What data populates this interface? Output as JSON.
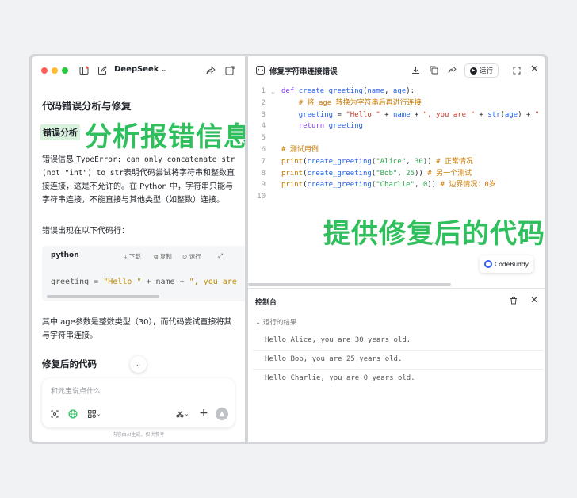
{
  "chat": {
    "app_name": "DeepSeek",
    "title": "代码错误分析与修复",
    "section_chip": "错误分析",
    "overlay_left": "分析报错信息",
    "para1_pre": "错误信息 ",
    "para1_code1": "TypeError: can only concatenate str (not \"int\") to str",
    "para1_post": "表明代码尝试将字符串和整数直接连接，这是不允许的。在 Python 中，字符串只能与字符串连接，不能直接与其他类型（如整数）连接。",
    "para2": "错误出现在以下代码行：",
    "code_block": {
      "lang": "python",
      "download": "下载",
      "copy": "复制",
      "run": "运行",
      "code_prefix": "greeting = ",
      "code_str1": "\"Hello \"",
      "code_mid": " + name + ",
      "code_str2": "\", you are"
    },
    "para3": "其中 age参数是整数类型（30），而代码尝试直接将其与字符串连接。",
    "subtitle": "修复后的代码",
    "input_placeholder": "和元宝说点什么",
    "footer_note": "内容由AI生成，仅供参考"
  },
  "code_panel": {
    "file_title": "修复字符串连接错误",
    "run_label": "运行",
    "overlay_right": "提供修复后的代码",
    "buddy_label": "CodeBuddy",
    "lines": [
      {
        "n": "1",
        "html": "<span class=\"kw\">def</span> <span class=\"fn\">create_greeting</span>(<span class=\"id\">name</span>, <span class=\"id\">age</span>):",
        "fold": true
      },
      {
        "n": "2",
        "html": "    <span class=\"cm\"># 将 age 转换为字符串后再进行连接</span>"
      },
      {
        "n": "3",
        "html": "    <span class=\"id\">greeting</span> = <span class=\"str\">\"Hello \"</span> + <span class=\"id\">name</span> + <span class=\"str\">\", you are \"</span> + <span class=\"fn\">str</span>(<span class=\"id\">age</span>) + <span class=\"str\">\"</span>"
      },
      {
        "n": "4",
        "html": "    <span class=\"kw\">return</span> <span class=\"id\">greeting</span>"
      },
      {
        "n": "5",
        "html": ""
      },
      {
        "n": "6",
        "html": "<span class=\"cm\"># 测试用例</span>"
      },
      {
        "n": "7",
        "html": "<span class=\"cm\">print</span>(<span class=\"fn\">create_greeting</span>(<span class=\"nm\">\"Alice\"</span>, <span class=\"nm\">30</span>))  <span class=\"cm\"># 正常情况</span>"
      },
      {
        "n": "8",
        "html": "<span class=\"cm\">print</span>(<span class=\"fn\">create_greeting</span>(<span class=\"nm\">\"Bob\"</span>, <span class=\"nm\">25</span>))    <span class=\"cm\"># 另一个测试</span>"
      },
      {
        "n": "9",
        "html": "<span class=\"cm\">print</span>(<span class=\"fn\">create_greeting</span>(<span class=\"nm\">\"Charlie\"</span>, <span class=\"nm\">0</span>))  <span class=\"cm\"># 边界情况：0岁</span>"
      },
      {
        "n": "10",
        "html": ""
      }
    ],
    "console": {
      "title": "控制台",
      "results_label": "运行的结果",
      "outputs": [
        "Hello Alice, you are 30 years old.",
        "Hello Bob, you are 25 years old.",
        "Hello Charlie, you are 0 years old."
      ]
    }
  },
  "colors": {
    "overlay_green": "#2fbf5c",
    "chip_bg": "#d9f2de",
    "traffic_red": "#ff5f57",
    "traffic_yellow": "#febc2e",
    "traffic_green": "#28c840"
  }
}
